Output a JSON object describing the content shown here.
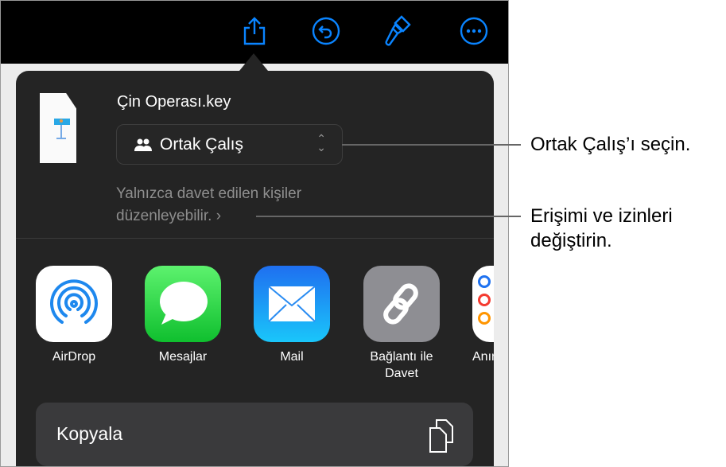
{
  "toolbar": {
    "icons": [
      "share-icon",
      "undo-icon",
      "paintbrush-icon",
      "more-icon"
    ],
    "accent": "#0a84ff"
  },
  "share_sheet": {
    "file_name": "Çin Operası.key",
    "collab_select": {
      "value": "Ortak Çalış",
      "icon": "people-icon"
    },
    "access_description": "Yalnızca davet edilen kişiler düzenleyebilir.",
    "apps": [
      {
        "label": "AirDrop"
      },
      {
        "label": "Mesajlar"
      },
      {
        "label": "Mail"
      },
      {
        "label": "Bağlantı ile Davet"
      },
      {
        "label": "Anım"
      }
    ],
    "copy_label": "Kopyala"
  },
  "callouts": {
    "first": "Ortak Çalış’ı seçin.",
    "second": "Erişimi ve izinleri değiştirin."
  }
}
